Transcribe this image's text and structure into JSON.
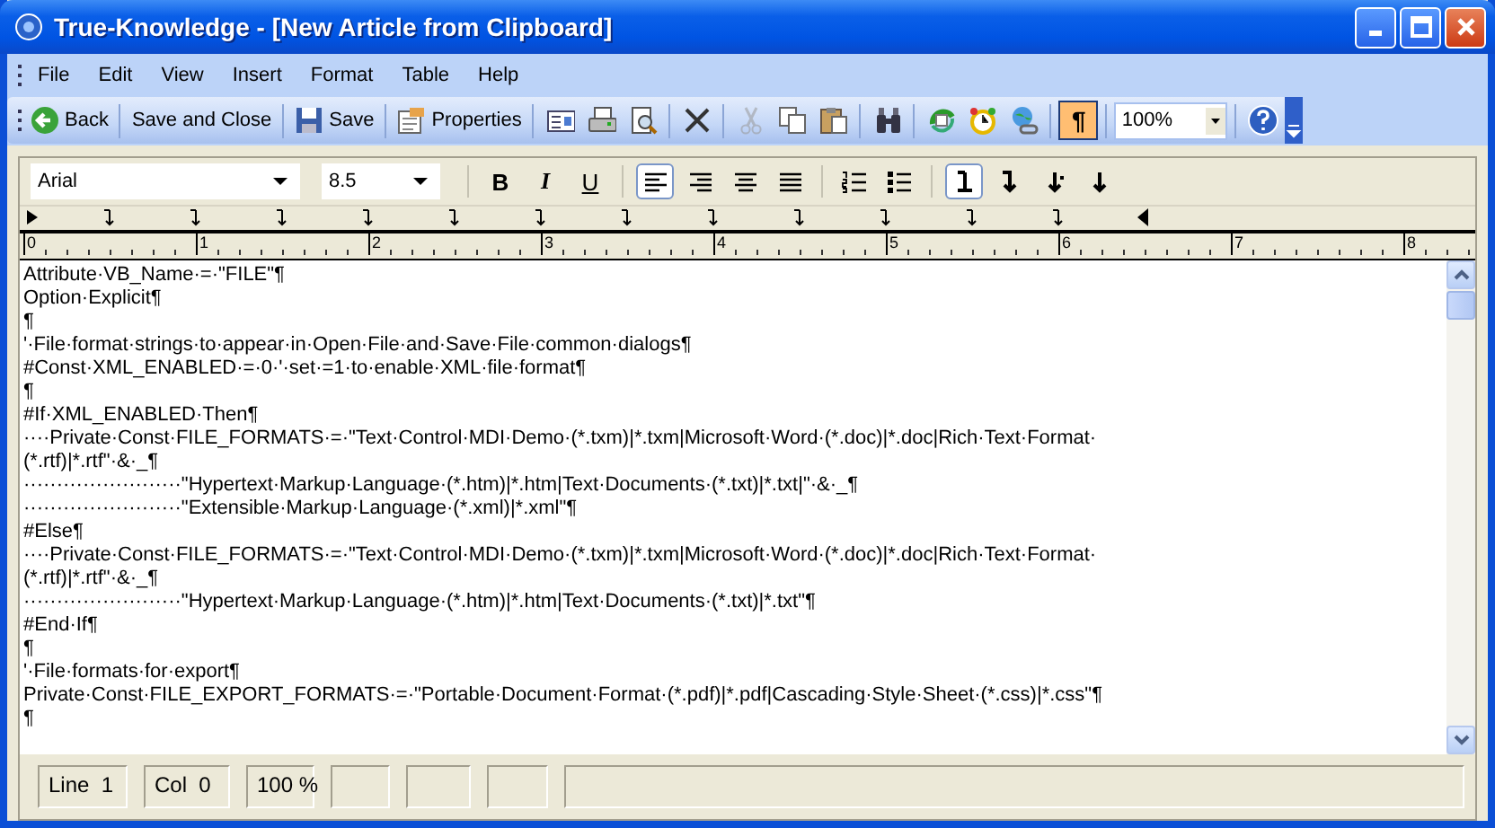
{
  "window": {
    "title": "True-Knowledge - [New Article from Clipboard]"
  },
  "menu": [
    "File",
    "Edit",
    "View",
    "Insert",
    "Format",
    "Table",
    "Help"
  ],
  "toolbar": [
    {
      "kind": "button",
      "label": "Back"
    },
    {
      "kind": "separator"
    },
    {
      "kind": "button",
      "label": "Save and Close"
    },
    {
      "kind": "separator"
    },
    {
      "kind": "button",
      "label": "Save"
    },
    {
      "kind": "separator"
    },
    {
      "kind": "button",
      "label": "Properties"
    },
    {
      "kind": "separator"
    },
    {
      "kind": "icon",
      "disabled": false
    },
    {
      "kind": "icon",
      "disabled": false
    },
    {
      "kind": "icon",
      "disabled": false
    },
    {
      "kind": "separator"
    },
    {
      "kind": "icon",
      "disabled": false
    },
    {
      "kind": "separator"
    },
    {
      "kind": "icon",
      "disabled": true
    },
    {
      "kind": "icon",
      "disabled": false
    },
    {
      "kind": "icon",
      "disabled": false
    },
    {
      "kind": "separator"
    },
    {
      "kind": "icon",
      "disabled": false
    },
    {
      "kind": "separator"
    },
    {
      "kind": "icon",
      "disabled": false
    },
    {
      "kind": "icon",
      "disabled": false
    },
    {
      "kind": "icon",
      "disabled": false
    },
    {
      "kind": "separator"
    },
    {
      "kind": "toggle",
      "label": "¶",
      "selected": true
    },
    {
      "kind": "separator"
    },
    {
      "kind": "combo",
      "value": "100%"
    },
    {
      "kind": "separator"
    },
    {
      "kind": "icon",
      "disabled": false
    }
  ],
  "format_bar": {
    "font": "Arial",
    "size": "8.5",
    "styles": [
      {
        "label": "B",
        "selected": false
      },
      {
        "label": "I",
        "selected": false
      },
      {
        "label": "U",
        "selected": false
      }
    ],
    "alignment": [
      {
        "selected": true
      },
      {
        "selected": false
      },
      {
        "selected": false
      },
      {
        "selected": false
      }
    ],
    "tab_types": [
      {
        "selected": true
      },
      {
        "selected": false
      },
      {
        "selected": false
      },
      {
        "selected": false
      }
    ]
  },
  "ruler": {
    "labels": [
      "0",
      "1",
      "2",
      "3",
      "4",
      "5",
      "6",
      "7",
      "8"
    ]
  },
  "document": {
    "lines": [
      "Attribute·VB_Name·=·\"FILE\"¶",
      "Option·Explicit¶",
      "¶",
      "'·File·format·strings·to·appear·in·Open·File·and·Save·File·common·dialogs¶",
      "#Const·XML_ENABLED·=·0·'·set·=1·to·enable·XML·file·format¶",
      "¶",
      "#If·XML_ENABLED·Then¶",
      "····Private·Const·FILE_FORMATS·=·\"Text·Control·MDI·Demo·(*.txm)|*.txm|Microsoft·Word·(*.doc)|*.doc|Rich·Text·Format·",
      "(*.rtf)|*.rtf\"·&·_¶",
      "························\"Hypertext·Markup·Language·(*.htm)|*.htm|Text·Documents·(*.txt)|*.txt|\"·&·_¶",
      "························\"Extensible·Markup·Language·(*.xml)|*.xml\"¶",
      "#Else¶",
      "····Private·Const·FILE_FORMATS·=·\"Text·Control·MDI·Demo·(*.txm)|*.txm|Microsoft·Word·(*.doc)|*.doc|Rich·Text·Format·",
      "(*.rtf)|*.rtf\"·&·_¶",
      "························\"Hypertext·Markup·Language·(*.htm)|*.htm|Text·Documents·(*.txt)|*.txt\"¶",
      "#End·If¶",
      "¶",
      "'·File·formats·for·export¶",
      "Private·Const·FILE_EXPORT_FORMATS·=·\"Portable·Document·Format·(*.pdf)|*.pdf|Cascading·Style·Sheet·(*.css)|*.css\"¶",
      "¶"
    ]
  },
  "status_bar": [
    "Line  1",
    "Col  0",
    "100 %"
  ]
}
